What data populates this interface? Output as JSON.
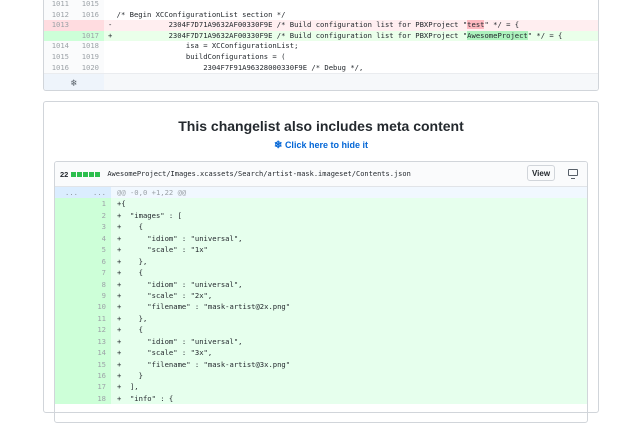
{
  "top_diff": {
    "lines": [
      {
        "type": "ctx",
        "old": "1011",
        "new": "1015",
        "code": ""
      },
      {
        "type": "ctx",
        "old": "1012",
        "new": "1016",
        "code": "/* Begin XCConfigurationList section */"
      },
      {
        "type": "del",
        "old": "1013",
        "new": "",
        "marker": "-",
        "pre": "            2304F7D71A9632AF00330F9E /* Build configuration list for PBXProject \"",
        "hl": "test",
        "post": "\" */ = {"
      },
      {
        "type": "add",
        "old": "",
        "new": "1017",
        "marker": "+",
        "pre": "            2304F7D71A9632AF00330F9E /* Build configuration list for PBXProject \"",
        "hl": "AwesomeProject",
        "post": "\" */ = {"
      },
      {
        "type": "ctx",
        "old": "1014",
        "new": "1018",
        "code": "                isa = XCConfigurationList;"
      },
      {
        "type": "ctx",
        "old": "1015",
        "new": "1019",
        "code": "                buildConfigurations = ("
      },
      {
        "type": "ctx",
        "old": "1016",
        "new": "1020",
        "code": "                    2304F7F91A96328000330F9E /* Debug */,"
      }
    ],
    "expander_icon": "unfold-icon"
  },
  "meta": {
    "title": "This changelist also includes meta content",
    "hide_link": "Click here to hide it",
    "hide_icon": "snowflake-icon"
  },
  "file": {
    "count": "22",
    "path": "AwesomeProject/Images.xcassets/Search/artist-mask.imageset/Contents.json",
    "view_button": "View",
    "hunk": {
      "old": "...",
      "new": "...",
      "text": "@@ -0,0 +1,22 @@"
    },
    "lines": [
      {
        "n": "1",
        "code": "+{"
      },
      {
        "n": "2",
        "code": "+  \"images\" : ["
      },
      {
        "n": "3",
        "code": "+    {"
      },
      {
        "n": "4",
        "code": "+      \"idiom\" : \"universal\","
      },
      {
        "n": "5",
        "code": "+      \"scale\" : \"1x\""
      },
      {
        "n": "6",
        "code": "+    },"
      },
      {
        "n": "7",
        "code": "+    {"
      },
      {
        "n": "8",
        "code": "+      \"idiom\" : \"universal\","
      },
      {
        "n": "9",
        "code": "+      \"scale\" : \"2x\","
      },
      {
        "n": "10",
        "code": "+      \"filename\" : \"mask-artist@2x.png\""
      },
      {
        "n": "11",
        "code": "+    },"
      },
      {
        "n": "12",
        "code": "+    {"
      },
      {
        "n": "13",
        "code": "+      \"idiom\" : \"universal\","
      },
      {
        "n": "14",
        "code": "+      \"scale\" : \"3x\","
      },
      {
        "n": "15",
        "code": "+      \"filename\" : \"mask-artist@3x.png\""
      },
      {
        "n": "16",
        "code": "+    }"
      },
      {
        "n": "17",
        "code": "+  ],"
      },
      {
        "n": "18",
        "code": "+  \"info\" : {"
      }
    ]
  },
  "colors": {
    "add_bg": "#e6ffed",
    "del_bg": "#ffeef0",
    "link": "#0366d6",
    "diffstat": "#2cbe4e"
  }
}
